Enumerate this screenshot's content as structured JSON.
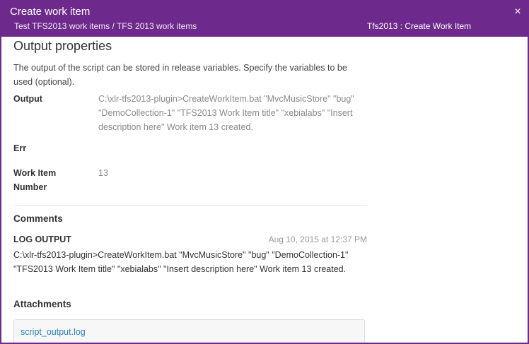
{
  "header": {
    "title": "Create work item",
    "breadcrumb": "Test TFS2013 work items / TFS 2013 work items",
    "task_type": "Tfs2013 : Create Work Item",
    "close_symbol": "×"
  },
  "output_properties": {
    "title": "Output properties",
    "description": "The output of the script can be stored in release variables. Specify the variables to be used (optional).",
    "fields": [
      {
        "label": "Output",
        "value": "C:\\xlr-tfs2013-plugin>CreateWorkItem.bat \"MvcMusicStore\" \"bug\" \"DemoCollection-1\" \"TFS2013 Work Item title\" \"xebialabs\" \"Insert description here\" Work item 13 created."
      },
      {
        "label": "Err",
        "value": ""
      },
      {
        "label": "Work Item Number",
        "value": "13"
      }
    ]
  },
  "comments": {
    "title": "Comments",
    "items": [
      {
        "author": "LOG OUTPUT",
        "date": "Aug 10, 2015 at 12:37 PM",
        "text": "C:\\xlr-tfs2013-plugin>CreateWorkItem.bat \"MvcMusicStore\" \"bug\" \"DemoCollection-1\" \"TFS2013 Work Item title\" \"xebialabs\" \"Insert description here\" Work item 13 created."
      }
    ]
  },
  "attachments": {
    "title": "Attachments",
    "items": [
      {
        "name": "script_output.log"
      }
    ]
  },
  "colors": {
    "header_bg": "#6d2a8c",
    "link": "#2a7fc1"
  }
}
